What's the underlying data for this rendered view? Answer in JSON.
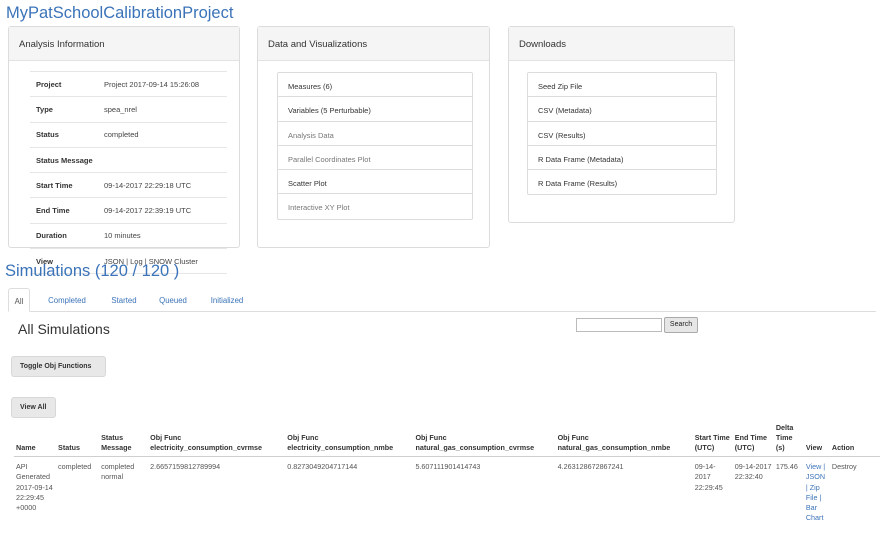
{
  "project_title": "MyPatSchoolCalibrationProject",
  "analysis_panel": {
    "title": "Analysis Information",
    "rows": [
      {
        "key": "Project",
        "value": "Project 2017-09-14 15:26:08"
      },
      {
        "key": "Type",
        "value": "spea_nrel"
      },
      {
        "key": "Status",
        "value": "completed"
      },
      {
        "key": "Status Message",
        "value": ""
      },
      {
        "key": "Start Time",
        "value": "09-14-2017 22:29:18 UTC"
      },
      {
        "key": "End Time",
        "value": "09-14-2017 22:39:19 UTC"
      },
      {
        "key": "Duration",
        "value": "10 minutes"
      },
      {
        "key": "View",
        "value": "JSON | Log | SNOW Cluster"
      }
    ]
  },
  "data_panel": {
    "title": "Data and Visualizations",
    "items": [
      {
        "label": "Measures (6)"
      },
      {
        "label": "Variables (5 Perturbable)"
      },
      {
        "label": "Analysis Data"
      },
      {
        "label": "Parallel Coordinates Plot"
      },
      {
        "label": "Scatter Plot"
      },
      {
        "label": "Interactive XY Plot"
      }
    ]
  },
  "downloads_panel": {
    "title": "Downloads",
    "items": [
      {
        "label": "Seed Zip File"
      },
      {
        "label": "CSV (Metadata)"
      },
      {
        "label": "CSV (Results)"
      },
      {
        "label": "R Data Frame (Metadata)"
      },
      {
        "label": "R Data Frame (Results)"
      }
    ]
  },
  "simulations": {
    "title": "Simulations (120 / 120 )",
    "tabs": [
      "All",
      "Completed",
      "Started",
      "Queued",
      "Initialized"
    ],
    "active_tab": "All",
    "heading": "All Simulations",
    "search_placeholder": "",
    "search_label": "Search",
    "toggle_label": "Toggle Obj Functions",
    "view_all_label": "View All",
    "columns": [
      "Name",
      "Status",
      "Status Message",
      "Obj Func electricity_consumption_cvrmse",
      "Obj Func electricity_consumption_nmbe",
      "Obj Func natural_gas_consumption_cvrmse",
      "Obj Func natural_gas_consumption_nmbe",
      "Start Time (UTC)",
      "End Time (UTC)",
      "Delta Time (s)",
      "View",
      "Action"
    ],
    "rows": [
      {
        "name": "API Generated 2017-09-14 22:29:45 +0000",
        "status": "completed",
        "status_message": "completed normal",
        "elec_cvrmse": "2.6657159812789994",
        "elec_nmbe": "0.8273049204717144",
        "gas_cvrmse": "5.607111901414743",
        "gas_nmbe": "4.263128672867241",
        "start": "09-14-2017 22:29:45",
        "end": "09-14-2017 22:32:40",
        "delta": "175.46",
        "view": "View | JSON | Zip File | Bar Chart",
        "action": "Destroy"
      }
    ]
  },
  "colors": {
    "link": "#3b73b9",
    "panel_header_bg": "#f5f5f5",
    "button_bg": "#e8e8e8"
  }
}
